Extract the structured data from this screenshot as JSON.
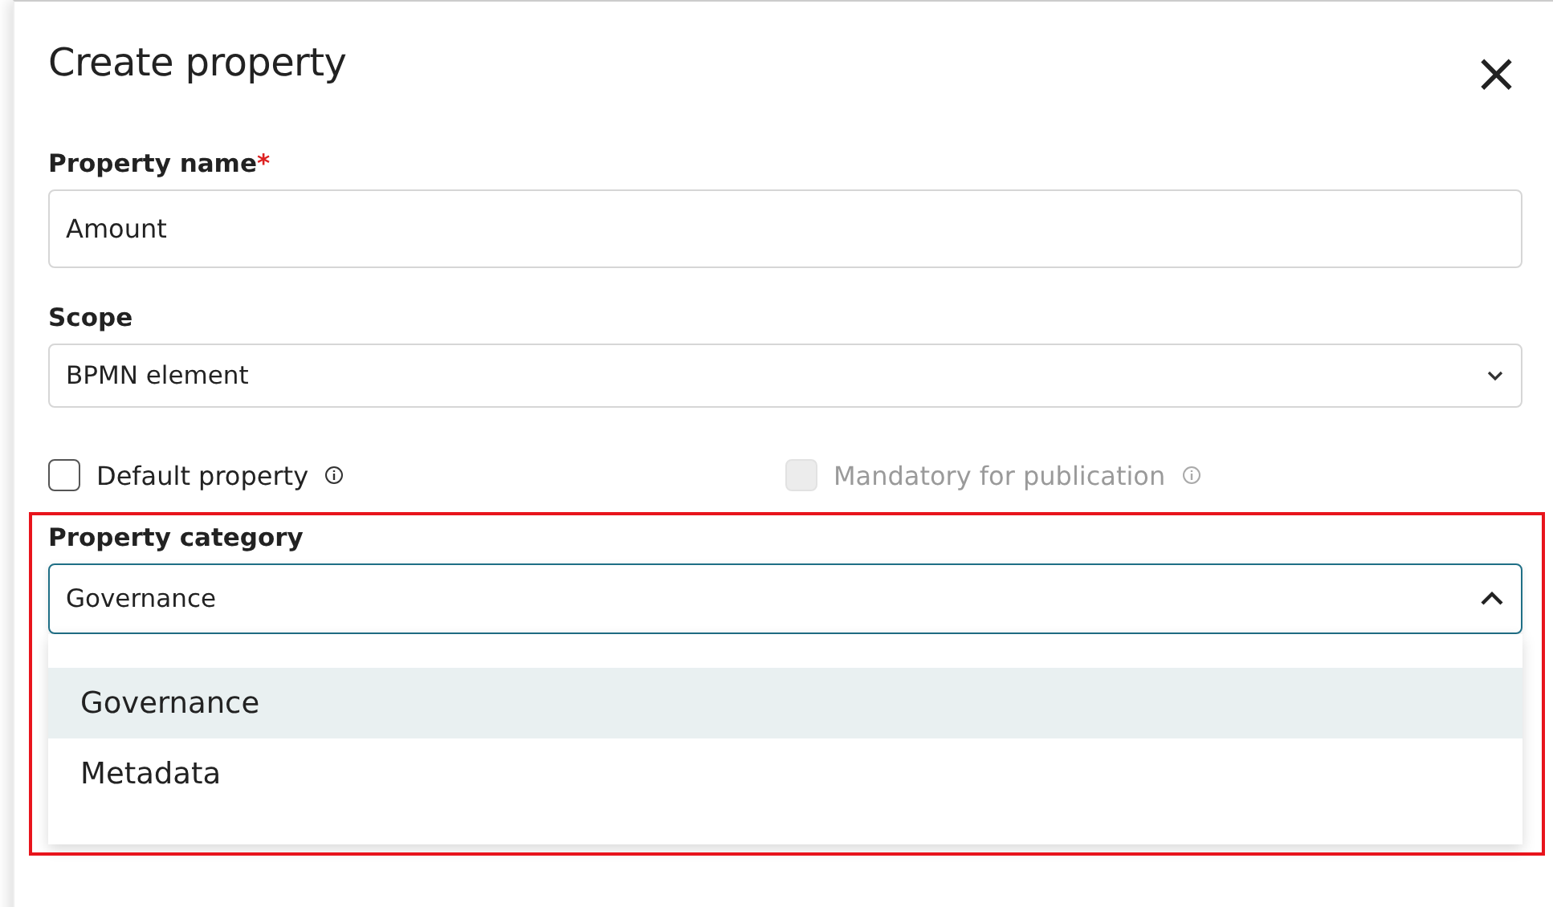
{
  "dialog": {
    "title": "Create property",
    "close": "×"
  },
  "property_name": {
    "label": "Property name",
    "required_mark": "*",
    "value": "Amount"
  },
  "scope": {
    "label": "Scope",
    "value": "BPMN element"
  },
  "checkboxes": [
    {
      "label": "Default property",
      "checked": false,
      "disabled": false
    },
    {
      "label": "Mandatory for publication",
      "checked": false,
      "disabled": true
    }
  ],
  "property_category": {
    "label": "Property category",
    "value": "Governance",
    "expanded": true,
    "options": [
      {
        "label": "Governance",
        "selected": true
      },
      {
        "label": "Metadata",
        "selected": false
      }
    ]
  },
  "highlight": true
}
